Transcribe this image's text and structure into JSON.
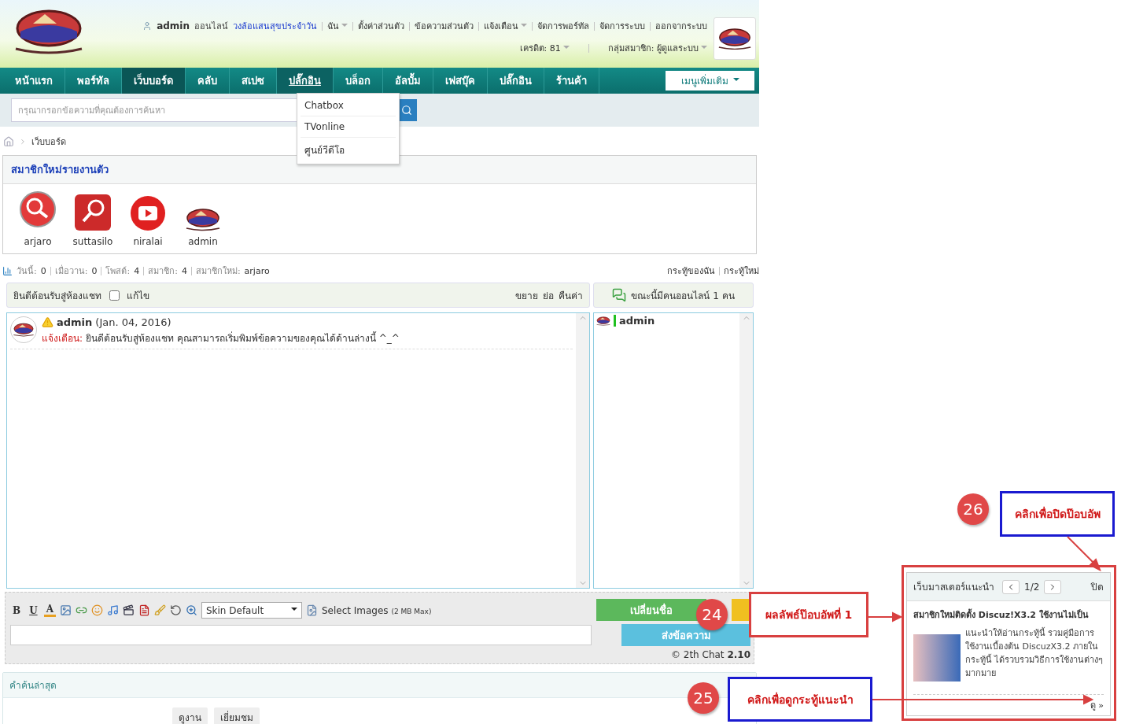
{
  "header": {
    "user": "admin",
    "status": "ออนไลน์",
    "daily_link": "วงล้อแสนสุขประจำวัน",
    "links": [
      {
        "label": "ฉัน",
        "dropdown": true
      },
      {
        "label": "ตั้งค่าส่วนตัว",
        "dropdown": false
      },
      {
        "label": "ข้อความส่วนตัว",
        "dropdown": false
      },
      {
        "label": "แจ้งเตือน",
        "dropdown": true
      },
      {
        "label": "จัดการพอร์ทัล",
        "dropdown": false
      },
      {
        "label": "จัดการระบบ",
        "dropdown": false
      },
      {
        "label": "ออกจากระบบ",
        "dropdown": false
      }
    ],
    "credit": "เครดิต: 81",
    "group": "กลุ่มสมาชิก: ผู้ดูแลระบบ"
  },
  "nav": {
    "items": [
      {
        "label": "หน้าแรก",
        "selected": false,
        "expanded": false
      },
      {
        "label": "พอร์ทัล",
        "selected": false,
        "expanded": false
      },
      {
        "label": "เว็บบอร์ด",
        "selected": true,
        "expanded": false
      },
      {
        "label": "คลับ",
        "selected": false,
        "expanded": false
      },
      {
        "label": "สเปซ",
        "selected": false,
        "expanded": false
      },
      {
        "label": "ปลั๊กอิน",
        "selected": false,
        "expanded": true
      },
      {
        "label": "บล็อก",
        "selected": false,
        "expanded": false
      },
      {
        "label": "อัลบั้ม",
        "selected": false,
        "expanded": false
      },
      {
        "label": "เฟสบุ๊ค",
        "selected": false,
        "expanded": false
      },
      {
        "label": "ปลั๊กอิน",
        "selected": false,
        "expanded": false
      },
      {
        "label": "ร้านค้า",
        "selected": false,
        "expanded": false
      }
    ],
    "more": "เมนูเพิ่มเติม",
    "dropdown": [
      "Chatbox",
      "TVonline",
      "ศูนย์วีดีโอ"
    ]
  },
  "search": {
    "placeholder": "กรุณากรอกข้อความที่คุณต้องการค้นหา"
  },
  "breadcrumb": "เว็บบอร์ด",
  "new_members": {
    "title": "สมาชิกใหม่รายงานตัว",
    "members": [
      {
        "name": "arjaro",
        "kind": "round"
      },
      {
        "name": "suttasilo",
        "kind": "square"
      },
      {
        "name": "niralai",
        "kind": "tube"
      },
      {
        "name": "admin",
        "kind": "logo"
      }
    ]
  },
  "stats": [
    {
      "label": "วันนี้:",
      "value": "0"
    },
    {
      "label": "เมื่อวาน:",
      "value": "0"
    },
    {
      "label": "โพสต์:",
      "value": "4"
    },
    {
      "label": "สมาชิก:",
      "value": "4"
    },
    {
      "label": "สมาชิกใหม่:",
      "value": "arjaro"
    }
  ],
  "thread_links": [
    "กระทู้ของฉัน",
    "กระทู้ใหม่"
  ],
  "chat": {
    "welcome": "ยินดีต้อนรับสู่ห้องแชท",
    "edit_checked": false,
    "edit": "แก้ไข",
    "size_links": [
      "ขยาย",
      "ย่อ",
      "คืนค่า"
    ],
    "online": "ขณะนี้มีคนออนไลน์ 1 คน",
    "messages": [
      {
        "user": "admin",
        "date": "(Jan. 04, 2016)",
        "label": "แจ้งเตือน:",
        "text": "ยินดีต้อนรับสู่ห้องแชท คุณสามารถเริ่มพิมพ์ข้อความของคุณได้ด้านล่างนี้ ^_^"
      }
    ],
    "online_users": [
      "admin"
    ],
    "format_buttons": [
      "B",
      "U",
      "A"
    ],
    "skin": "Skin Default",
    "select_images": "Select Images",
    "size_note": "(2 MB Max)",
    "rename": "เปลี่ยนชื่อ",
    "send": "ส่งข้อความ",
    "credit": "© 2th Chat",
    "version": "2.10"
  },
  "recent_search": {
    "title": "คำค้นล่าสุด",
    "tags": [
      "ดูงาน",
      "เยี่ยมชม"
    ]
  },
  "popup": {
    "title": "เว็บมาสเตอร์แนะนำ",
    "page": "1/2",
    "close": "ปิด",
    "headline": "สมาชิกใหม่ติดตั้ง Discuz!X3.2 ใช้งานไม่เป็น",
    "body": "แนะนำให้อ่านกระทู้นี้ รวมคู่มือการใช้งานเบื้องต้น DiscuzX3.2 ภายในกระทู้นี้ ได้รวบรวมวิธีการใช้งานต่างๆ มากมาย",
    "more": "ดู »"
  },
  "annotations": [
    {
      "number": "26",
      "text": "คลิกเพื่อปิดป๊อบอัพ",
      "color": "#1a1ad0"
    },
    {
      "number": "24",
      "text": "ผลลัพธ์ป๊อบอัพที่ 1",
      "color": "#d84040"
    },
    {
      "number": "25",
      "text": "คลิกเพื่อดูกระทู้แนะนำ",
      "color": "#1a1ad0"
    }
  ]
}
